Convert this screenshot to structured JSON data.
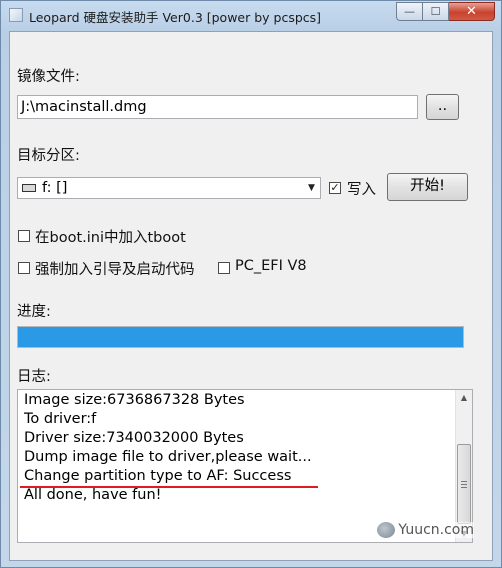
{
  "window": {
    "title": "Leopard 硬盘安装助手 Ver0.3 [power by pcspcs]",
    "controls": {
      "minimize": "—",
      "maximize": "☐",
      "close": "✕"
    }
  },
  "image_file": {
    "label": "镜像文件:",
    "value": "J:\\macinstall.dmg",
    "browse_label": ".."
  },
  "target_partition": {
    "label": "目标分区:",
    "selected": "f: []",
    "write_checkbox_label": "写入",
    "write_checked": true,
    "start_button": "开始!"
  },
  "options": {
    "boot_ini_label": "在boot.ini中加入tboot",
    "boot_ini_checked": false,
    "force_boot_label": "强制加入引导及启动代码",
    "force_boot_checked": false,
    "pc_efi_label": "PC_EFI V8",
    "pc_efi_checked": false
  },
  "progress": {
    "label": "进度:",
    "percent": 100,
    "color": "#2b9ae6"
  },
  "log": {
    "label": "日志:",
    "lines": [
      "Image size:6736867328 Bytes",
      "To driver:f",
      "Driver size:7340032000 Bytes",
      "Dump image file to driver,please wait...",
      "Change partition type to AF: Success",
      "All done, have fun!"
    ],
    "highlighted_line_index": 4,
    "highlight_color": "#e11b22"
  },
  "watermark": {
    "text": "Yuucn.com"
  }
}
